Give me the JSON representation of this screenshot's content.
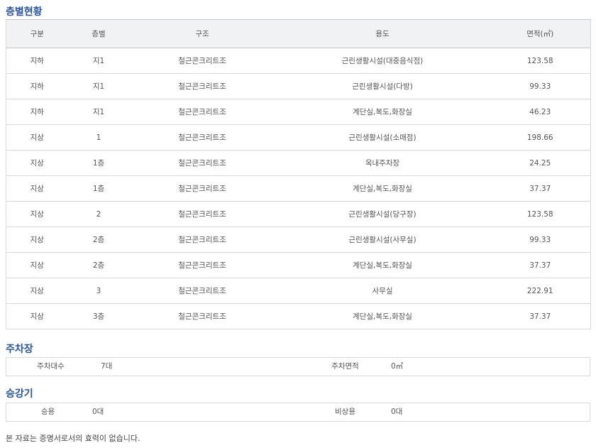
{
  "floor_section": {
    "title": "층별현황",
    "headers": [
      "구분",
      "층별",
      "구조",
      "용도",
      "면적(㎡)"
    ],
    "rows": [
      [
        "지하",
        "지1",
        "철근콘크리트조",
        "근린생활시설(대중음식점)",
        "123.58"
      ],
      [
        "지하",
        "지1",
        "철근콘크리트조",
        "근린생활시설(다방)",
        "99.33"
      ],
      [
        "지하",
        "지1",
        "철근콘크리트조",
        "계단실,복도,화장실",
        "46.23"
      ],
      [
        "지상",
        "1",
        "철근콘크리트조",
        "근린생활시설(소매점)",
        "198.66"
      ],
      [
        "지상",
        "1층",
        "철근콘크리트조",
        "옥내주차장",
        "24.25"
      ],
      [
        "지상",
        "1층",
        "철근콘크리트조",
        "계단실,복도,화장실",
        "37.37"
      ],
      [
        "지상",
        "2",
        "철근콘크리트조",
        "근린생활시설(당구장)",
        "123.58"
      ],
      [
        "지상",
        "2층",
        "철근콘크리트조",
        "근린생활시설(사무실)",
        "99.33"
      ],
      [
        "지상",
        "2층",
        "철근콘크리트조",
        "계단실,복도,화장실",
        "37.37"
      ],
      [
        "지상",
        "3",
        "철근콘크리트조",
        "사무실",
        "222.91"
      ],
      [
        "지상",
        "3층",
        "철근콘크리트조",
        "계단실,복도,화장실",
        "37.37"
      ]
    ]
  },
  "parking": {
    "title": "주차장",
    "count_label": "주차대수",
    "count_value": "7대",
    "area_label": "주차면적",
    "area_value": "0㎡"
  },
  "elevator": {
    "title": "승강기",
    "passenger_label": "승용",
    "passenger_value": "0대",
    "emergency_label": "비상용",
    "emergency_value": "0대"
  },
  "note": "본 자료는 증명서로서의 효력이 없습니다."
}
